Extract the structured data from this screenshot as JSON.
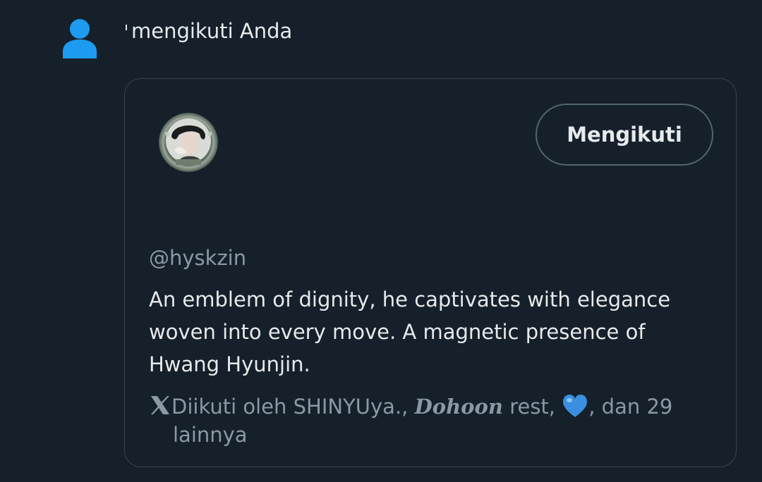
{
  "notification": {
    "icon": "person-icon",
    "text": "mengikuti Anda",
    "accent_color": "#1d9bf0"
  },
  "card": {
    "avatar": "profile-avatar",
    "follow_button_label": "Mengikuti",
    "handle": "@hyskzin",
    "bio": "An emblem of dignity, he captivates with elegance woven into every move. A magnetic presence of Hwang Hyunjin.",
    "followed_by": {
      "icon": "x-logo-icon",
      "prefix": "Diikuti oleh SHINYUya.,",
      "name_fancy": "Dohoon",
      "name_rest": "rest,",
      "emoji": "blue-heart-icon",
      "suffix_line1": ", dan 29",
      "suffix_line2": "lainnya"
    }
  },
  "colors": {
    "background": "#15202b",
    "text_primary": "#e7e9ea",
    "text_secondary": "#8b98a5",
    "border": "#38444d"
  }
}
